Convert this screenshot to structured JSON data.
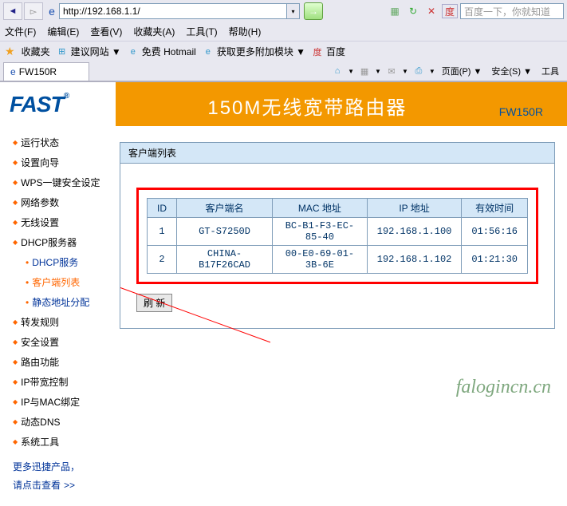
{
  "browser": {
    "url": "http://192.168.1.1/",
    "search_placeholder": "百度一下，你就知道",
    "menu": {
      "file": "文件(F)",
      "edit": "编辑(E)",
      "view": "查看(V)",
      "favorites": "收藏夹(A)",
      "tools": "工具(T)",
      "help": "帮助(H)"
    },
    "fav": {
      "label": "收藏夹",
      "suggest": "建议网站 ▼",
      "hotmail": "免费 Hotmail",
      "addons": "获取更多附加模块 ▼",
      "baidu": "百度"
    },
    "tab_title": "FW150R",
    "pagetools": {
      "page": "页面(P) ▼",
      "safety": "安全(S) ▼",
      "tools": "工具"
    }
  },
  "banner": {
    "logo": "FAST",
    "title": "150M无线宽带路由器",
    "model": "FW150R"
  },
  "sidebar": {
    "items": [
      "运行状态",
      "设置向导",
      "WPS一键安全设定",
      "网络参数",
      "无线设置",
      "DHCP服务器"
    ],
    "sub": [
      "DHCP服务",
      "客户端列表",
      "静态地址分配"
    ],
    "items2": [
      "转发规则",
      "安全设置",
      "路由功能",
      "IP带宽控制",
      "IP与MAC绑定",
      "动态DNS",
      "系统工具"
    ],
    "more1": "更多迅捷产品，",
    "more2": "请点击查看",
    "more_arrow": ">>"
  },
  "panel": {
    "title": "客户端列表",
    "headers": {
      "id": "ID",
      "name": "客户端名",
      "mac": "MAC 地址",
      "ip": "IP 地址",
      "time": "有效时间"
    },
    "rows": [
      {
        "id": "1",
        "name": "GT-S7250D",
        "mac": "BC-B1-F3-EC-85-40",
        "ip": "192.168.1.100",
        "time": "01:56:16"
      },
      {
        "id": "2",
        "name": "CHINA-B17F26CAD",
        "mac": "00-E0-69-01-3B-6E",
        "ip": "192.168.1.102",
        "time": "01:21:30"
      }
    ],
    "refresh": "刷 新"
  },
  "watermark": "falogincn.cn"
}
